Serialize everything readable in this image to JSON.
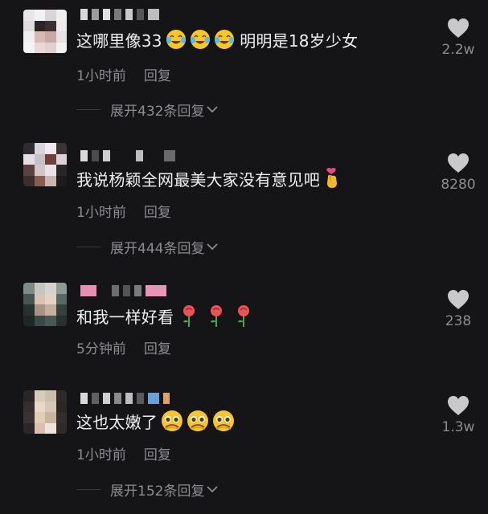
{
  "comments": [
    {
      "text": "这哪里像33",
      "text_after": " 明明是18岁少女",
      "time": "1小时前",
      "reply": "回复",
      "expand": "展开432条回复",
      "likes": "2.2w"
    },
    {
      "text": "我说杨颖全网最美大家没有意见吧",
      "time": "1小时前",
      "reply": "回复",
      "expand": "展开444条回复",
      "likes": "8280"
    },
    {
      "text": "和我一样好看",
      "time": "5分钟前",
      "reply": "回复",
      "likes": "238"
    },
    {
      "text": "这也太嫩了",
      "time": "1小时前",
      "reply": "回复",
      "expand": "展开152条回复",
      "likes": "1.3w"
    }
  ],
  "icons": {
    "like": "heart-icon",
    "expand_arrow": "chevron-down-icon",
    "emoji_1": "crying-laughing-emoji",
    "emoji_2": "finger-heart-emoji",
    "emoji_3": "rose-emoji",
    "emoji_4": "pleading-face-emoji"
  },
  "colors": {
    "background": "#151417",
    "text": "#efefef",
    "meta": "#8c8c91",
    "heart": "#c9c9cc"
  }
}
